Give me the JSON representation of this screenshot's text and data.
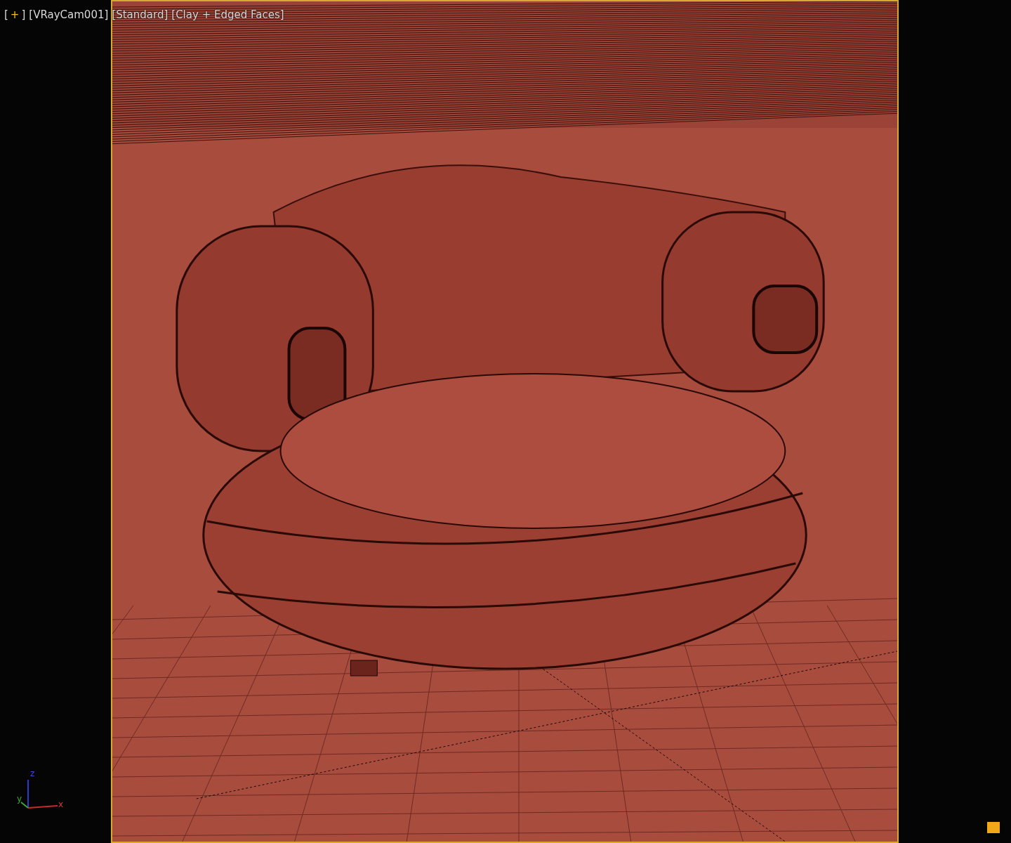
{
  "viewport": {
    "labels": [
      {
        "kind": "menu",
        "open": "[",
        "label": "+",
        "close": "]"
      },
      {
        "kind": "plain",
        "text": "[VRayCam001]"
      },
      {
        "kind": "plain",
        "text": "[Standard]"
      },
      {
        "kind": "plain",
        "text": "[Clay + Edged Faces]"
      }
    ],
    "axis_tripod": {
      "x": "x",
      "y": "y",
      "z": "z"
    }
  }
}
